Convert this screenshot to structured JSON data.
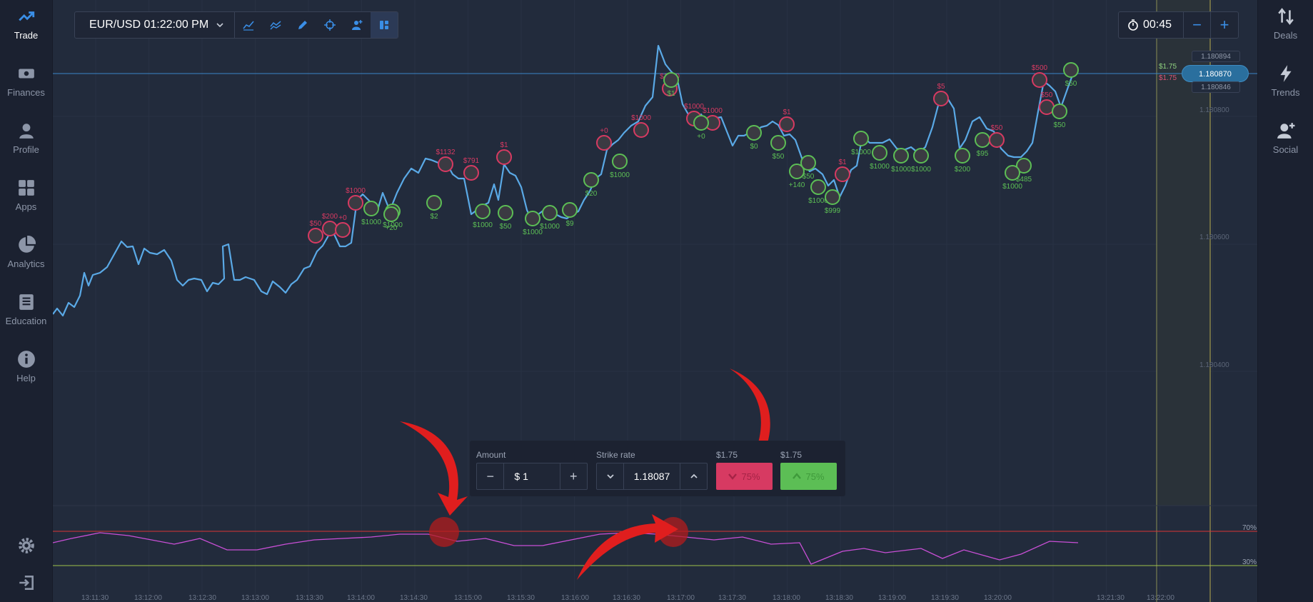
{
  "left_nav": [
    {
      "label": "Trade",
      "icon": "trending-up-icon",
      "active": true
    },
    {
      "label": "Finances",
      "icon": "cash-icon"
    },
    {
      "label": "Profile",
      "icon": "user-icon"
    },
    {
      "label": "Apps",
      "icon": "apps-grid-icon"
    },
    {
      "label": "Analytics",
      "icon": "pie-chart-icon"
    },
    {
      "label": "Education",
      "icon": "book-icon"
    },
    {
      "label": "Help",
      "icon": "info-icon"
    }
  ],
  "right_nav": [
    {
      "label": "Deals",
      "icon": "sort-arrows-icon"
    },
    {
      "label": "Trends",
      "icon": "lightning-icon"
    },
    {
      "label": "Social",
      "icon": "add-user-icon"
    }
  ],
  "toolbar": {
    "symbol": "EUR/USD 01:22:00 PM",
    "tools": [
      "line-chart-icon",
      "indicators-icon",
      "pencil-icon",
      "crosshair-icon",
      "add-user-icon",
      "layout-icon"
    ]
  },
  "timer": {
    "value": "00:45",
    "minus": "−",
    "plus": "+"
  },
  "price_axis": {
    "current": "1.180870",
    "upper_tag": "1.180894",
    "lower_tag": "1.180846",
    "levels": [
      "1.180800",
      "1.180600",
      "1.180400"
    ]
  },
  "payout_labels": {
    "call": "$1.75",
    "put": "$1.75"
  },
  "trade_panel": {
    "amount_label": "Amount",
    "amount_value": "$ 1",
    "minus": "−",
    "plus": "+",
    "strike_label": "Strike rate",
    "strike_value": "1.18087",
    "put_payout": "$1.75",
    "put_percent": "75%",
    "call_payout": "$1.75",
    "call_percent": "75%"
  },
  "rsi": {
    "upper": "70%",
    "lower": "30%"
  },
  "time_axis": [
    "13:11:30",
    "13:12:00",
    "13:12:30",
    "13:13:00",
    "13:13:30",
    "13:14:00",
    "13:14:30",
    "13:15:00",
    "13:15:30",
    "13:16:00",
    "13:16:30",
    "13:17:00",
    "13:17:30",
    "13:18:00",
    "13:18:30",
    "13:19:00",
    "13:19:30",
    "13:20:00",
    "13:21:30",
    "13:22:00"
  ],
  "trade_bubbles": [
    {
      "t": "$50",
      "c": "put"
    },
    {
      "t": "$200",
      "c": "put"
    },
    {
      "t": "+0",
      "c": "put"
    },
    {
      "t": "$1000",
      "c": "put"
    },
    {
      "t": "$1000",
      "c": "call"
    },
    {
      "t": "$1000",
      "c": "call"
    },
    {
      "t": "+20",
      "c": "call"
    },
    {
      "t": "$2",
      "c": "call"
    },
    {
      "t": "$1132",
      "c": "put"
    },
    {
      "t": "$791",
      "c": "put"
    },
    {
      "t": "$1000",
      "c": "call"
    },
    {
      "t": "$1",
      "c": "put"
    },
    {
      "t": "$50",
      "c": "call"
    },
    {
      "t": "$1000",
      "c": "call"
    },
    {
      "t": "$1000",
      "c": "call"
    },
    {
      "t": "$9",
      "c": "call"
    },
    {
      "t": "$20",
      "c": "call"
    },
    {
      "t": "+0",
      "c": "put"
    },
    {
      "t": "$1000",
      "c": "call"
    },
    {
      "t": "$1000",
      "c": "put"
    },
    {
      "t": "$1000",
      "c": "put"
    },
    {
      "t": "$1",
      "c": "call"
    },
    {
      "t": "$1000",
      "c": "put"
    },
    {
      "t": "$1000",
      "c": "put"
    },
    {
      "t": "+0",
      "c": "call"
    },
    {
      "t": "$1",
      "c": "put"
    },
    {
      "t": "$0",
      "c": "call"
    },
    {
      "t": "$50",
      "c": "call"
    },
    {
      "t": "+140",
      "c": "call"
    },
    {
      "t": "$50",
      "c": "call"
    },
    {
      "t": "$1000",
      "c": "call"
    },
    {
      "t": "$999",
      "c": "call"
    },
    {
      "t": "$1",
      "c": "put"
    },
    {
      "t": "$1000",
      "c": "call"
    },
    {
      "t": "$1000",
      "c": "call"
    },
    {
      "t": "$1000",
      "c": "call"
    },
    {
      "t": "$1000",
      "c": "call"
    },
    {
      "t": "$200",
      "c": "call"
    },
    {
      "t": "$5",
      "c": "put"
    },
    {
      "t": "$95",
      "c": "call"
    },
    {
      "t": "$50",
      "c": "put"
    },
    {
      "t": "$485",
      "c": "call"
    },
    {
      "t": "$1000",
      "c": "call"
    },
    {
      "t": "$500",
      "c": "put"
    },
    {
      "t": "$50",
      "c": "put"
    },
    {
      "t": "$50",
      "c": "call"
    },
    {
      "t": "$50",
      "c": "call"
    }
  ],
  "colors": {
    "price_line": "#5aa9e6",
    "rsi_line": "#c94fd6",
    "put": "#d73a62",
    "call": "#5cbe55",
    "annotation_arrow": "#e01e1e"
  }
}
